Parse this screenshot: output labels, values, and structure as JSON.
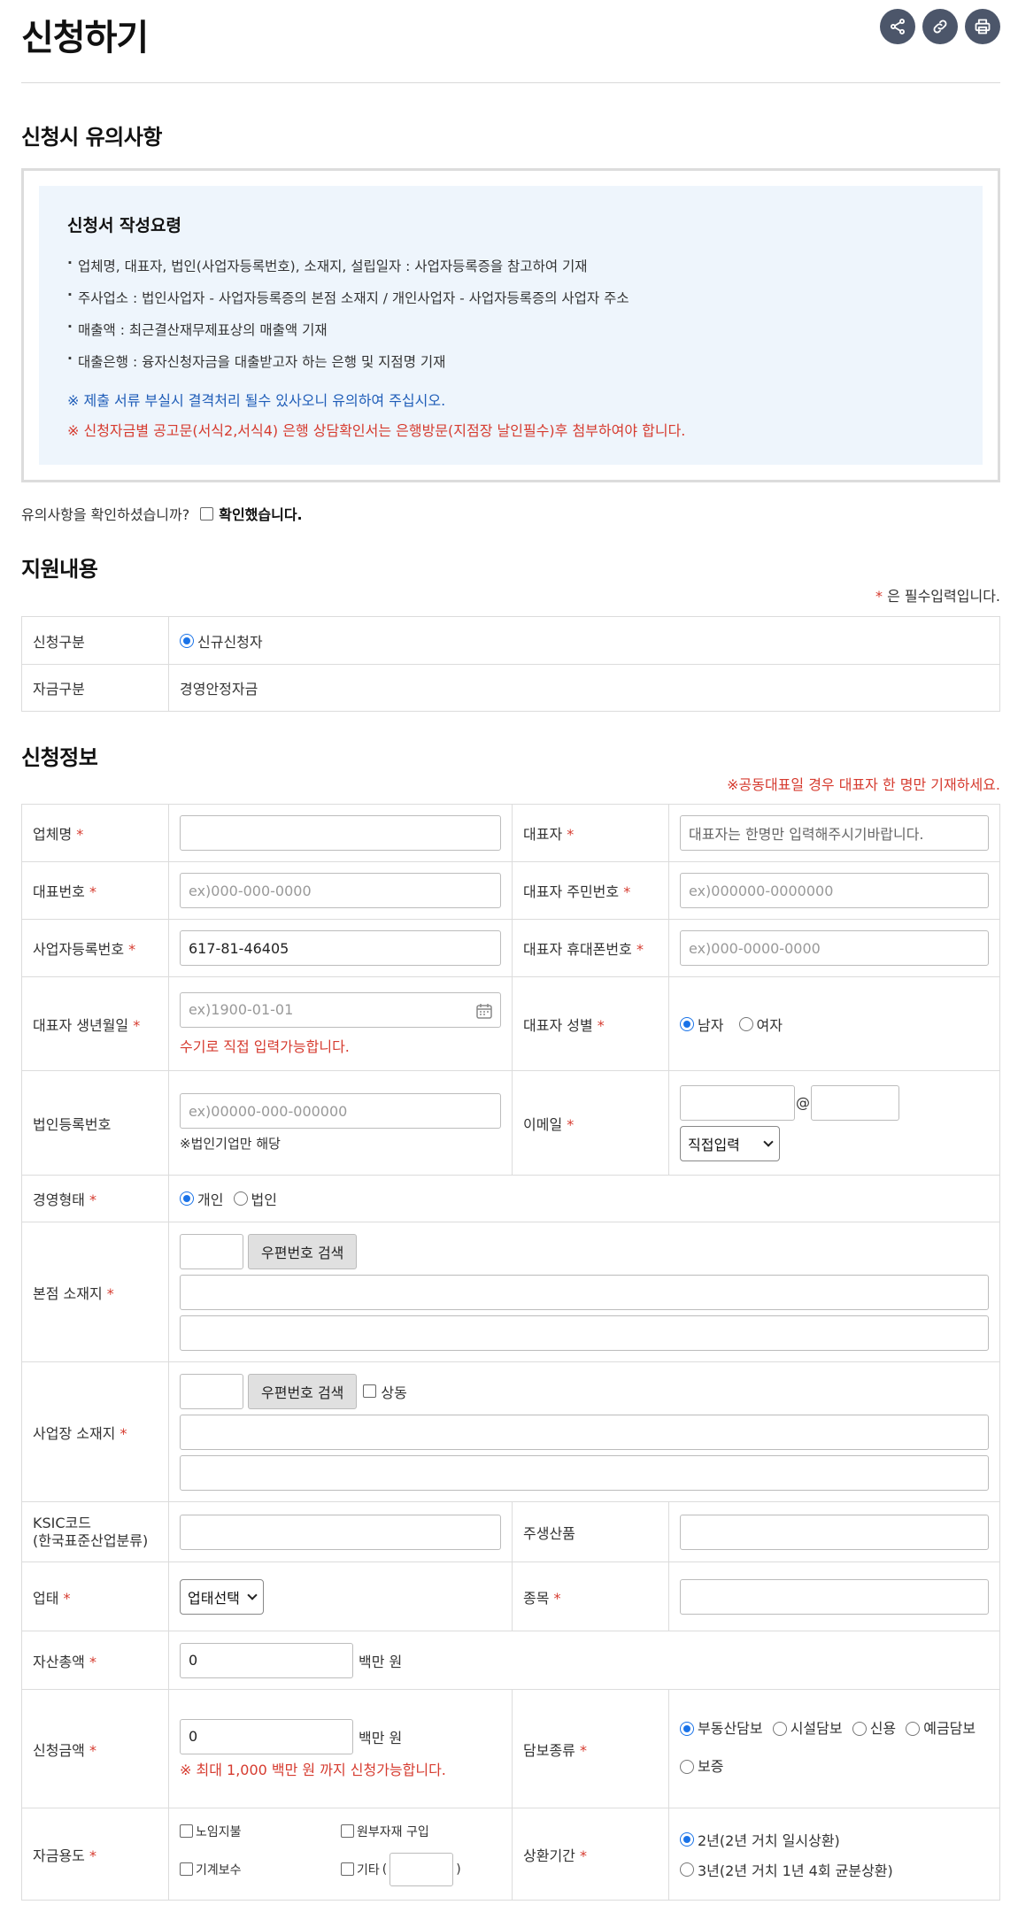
{
  "page": {
    "title": "신청하기",
    "share_icons": [
      "share-icon",
      "link-icon",
      "print-icon"
    ]
  },
  "notice": {
    "heading": "신청시 유의사항",
    "box_title": "신청서 작성요령",
    "items": [
      "업체명, 대표자, 법인(사업자등록번호), 소재지, 설립일자 : 사업자등록증을 참고하여 기재",
      "주사업소 : 법인사업자 - 사업자등록증의 본점 소재지 / 개인사업자 - 사업자등록증의 사업자 주소",
      "매출액 : 최근결산재무제표상의 매출액 기재",
      "대출은행 : 융자신청자금을 대출받고자 하는 은행 및 지점명 기재"
    ],
    "note_blue": "※ 제출 서류 부실시 결격처리 될수 있사오니 유의하여 주십시오.",
    "note_red": "※ 신청자금별 공고문(서식2,서식4) 은행 상담확인서는 은행방문(지점장 날인필수)후 첨부하여야 합니다.",
    "confirm_question": "유의사항을 확인하셨습니까?",
    "confirm_label": "확인했습니다."
  },
  "support": {
    "heading": "지원내용",
    "required_star": "*",
    "required_note": "은 필수입력입니다.",
    "rows": {
      "type_label": "신청구분",
      "type_option": "신규신청자",
      "fund_label": "자금구분",
      "fund_value": "경영안정자금"
    }
  },
  "applicant": {
    "heading": "신청정보",
    "warning": "※공동대표일 경우 대표자 한 명만 기재하세요.",
    "star": "*",
    "company_name_label": "업체명",
    "ceo_label": "대표자",
    "ceo_placeholder": "대표자는 한명만 입력해주시기바랍니다.",
    "phone_label": "대표번호",
    "phone_placeholder": "ex)000-000-0000",
    "ceo_id_label": "대표자 주민번호",
    "ceo_id_placeholder": "ex)000000-0000000",
    "bizno_label": "사업자등록번호",
    "bizno_value": "617-81-46405",
    "ceo_mobile_label": "대표자 휴대폰번호",
    "ceo_mobile_placeholder": "ex)000-0000-0000",
    "birth_label": "대표자 생년월일",
    "birth_placeholder": "ex)1900-01-01",
    "birth_hint": "수기로 직접 입력가능합니다.",
    "gender_label": "대표자 성별",
    "gender_options": [
      "남자",
      "여자"
    ],
    "corpno_label": "법인등록번호",
    "corpno_placeholder": "ex)00000-000-000000",
    "corpno_hint": "※법인기업만 해당",
    "email_label": "이메일",
    "email_at": "@",
    "email_domain_select": "직접입력",
    "biztype_label": "경영형태",
    "biztype_options": [
      "개인",
      "법인"
    ],
    "hq_label": "본점 소재지",
    "zip_button": "우편번호 검색",
    "site_label": "사업장 소재지",
    "same_label": "상동",
    "ksic_label_1": "KSIC코드",
    "ksic_label_2": "(한국표준산업분류)",
    "product_label": "주생산품",
    "industry_label": "업태",
    "industry_select": "업태선택",
    "item_label": "종목",
    "assets_label": "자산총액",
    "assets_value": "0",
    "unit_million": "백만 원",
    "amount_label": "신청금액",
    "amount_value": "0",
    "amount_hint": "※ 최대 1,000 백만 원 까지 신청가능합니다.",
    "collateral_label": "담보종류",
    "collateral_options": [
      "부동산담보",
      "시설담보",
      "신용",
      "예금담보",
      "보증"
    ],
    "usage_label": "자금용도",
    "usage_options": [
      "노임지불",
      "원부자재 구입",
      "기계보수",
      "기타"
    ],
    "usage_other_open": "(",
    "usage_other_close": ")",
    "repay_label": "상환기간",
    "repay_options": [
      "2년(2년 거치 일시상환)",
      "3년(2년 거치 1년 4회 균분상환)"
    ]
  }
}
